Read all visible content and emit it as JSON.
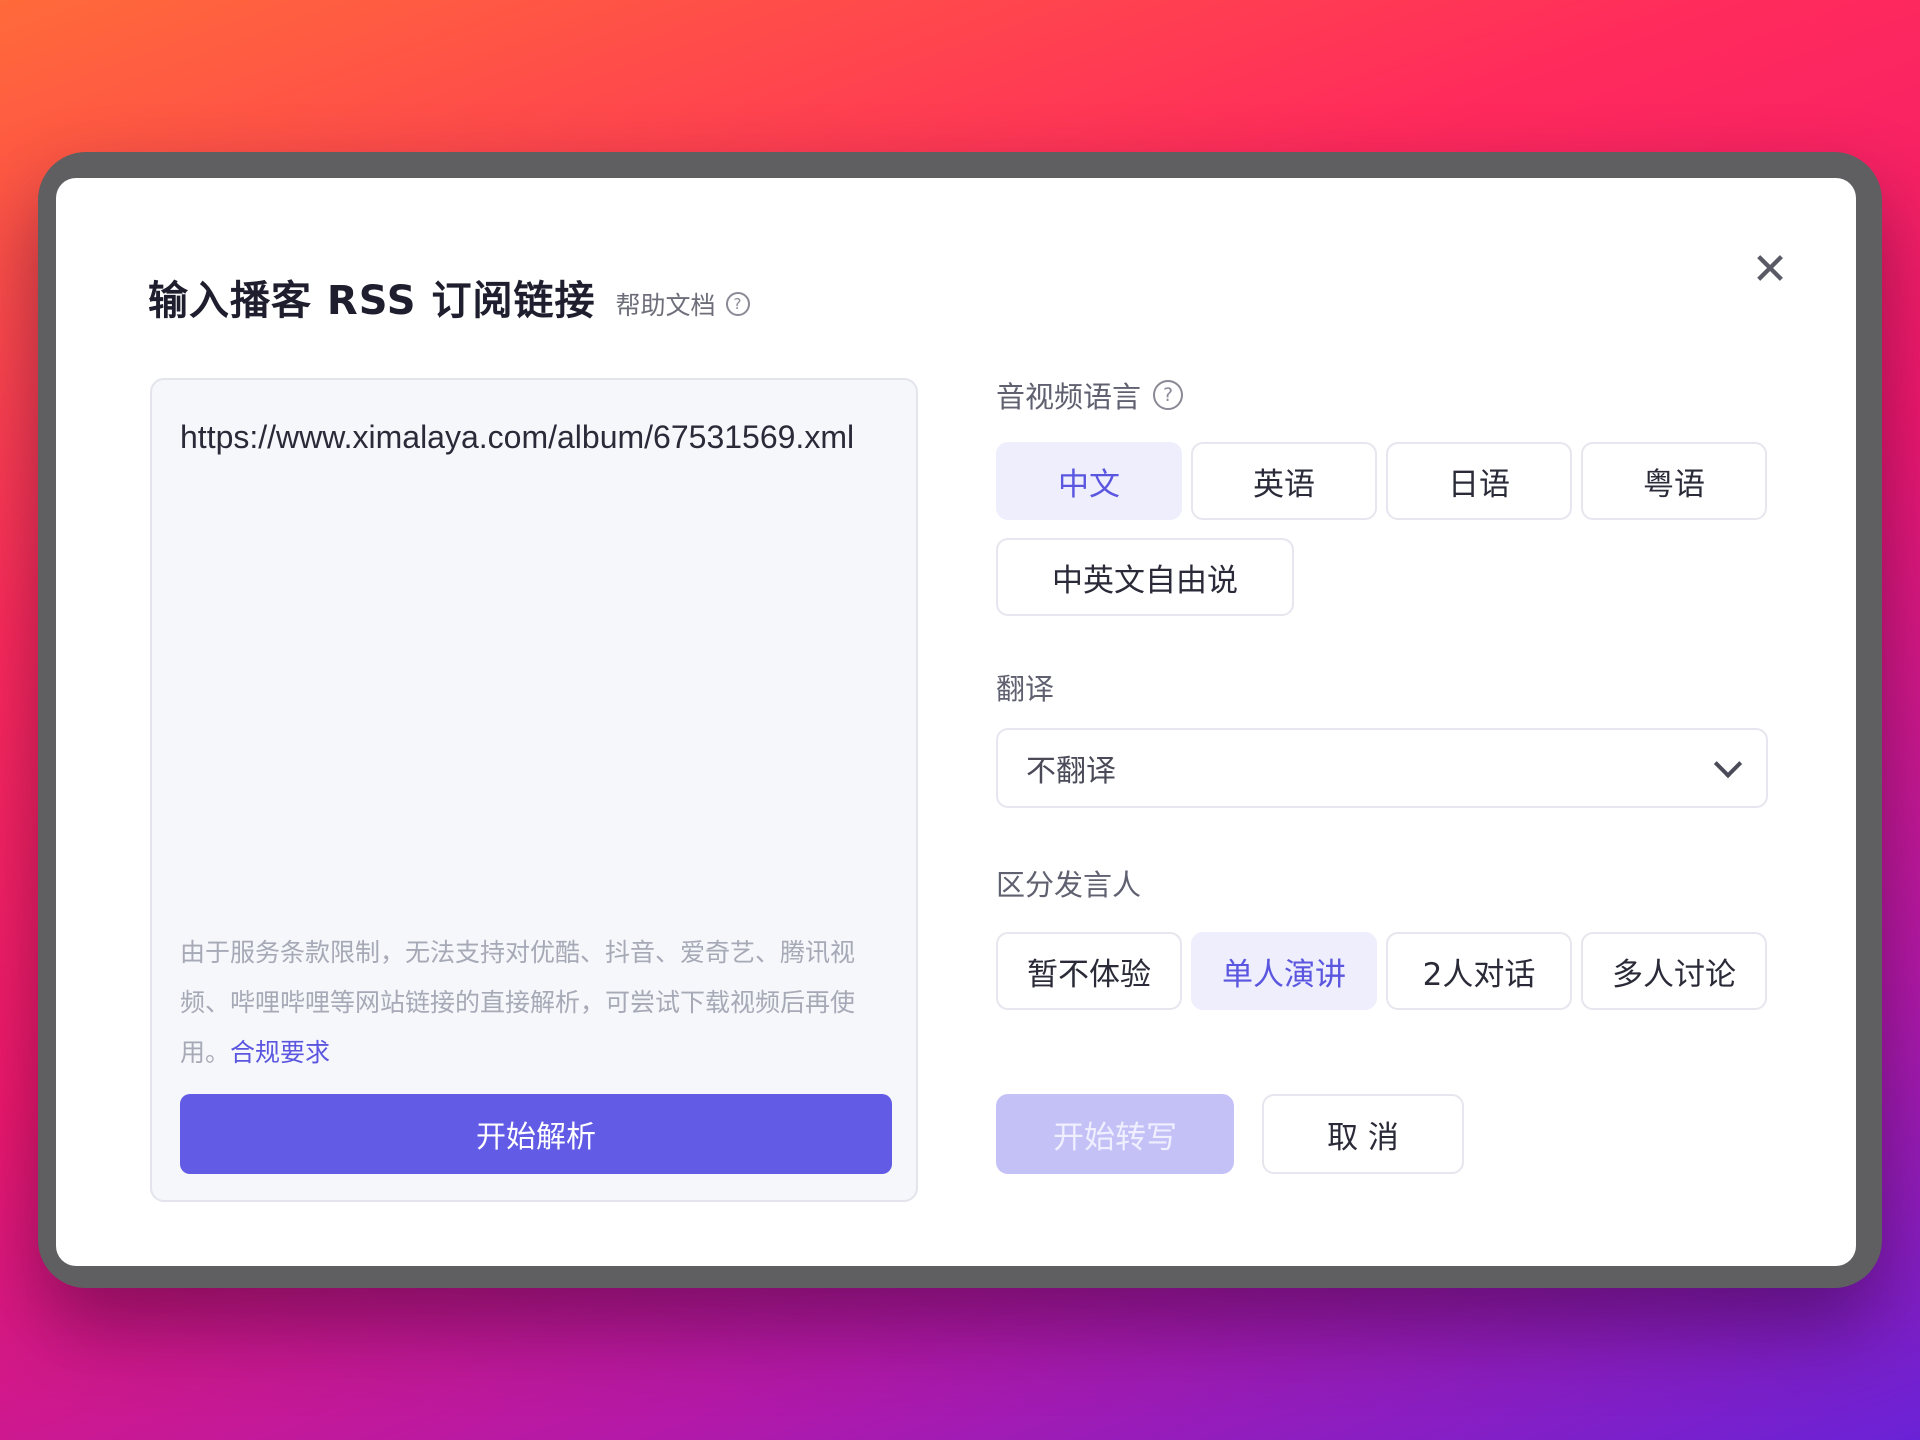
{
  "dialog": {
    "title": "输入播客 RSS 订阅链接",
    "help_label": "帮助文档",
    "help_icon": "question-circle-icon",
    "close_icon": "close-icon",
    "close_symbol": "✕"
  },
  "input": {
    "url_value": "https://www.ximalaya.com/album/67531569.xml",
    "notice_text": "由于服务条款限制，无法支持对优酷、抖音、爱奇艺、腾讯视频、哔哩哔哩等网站链接的直接解析，可尝试下载视频后再使用。",
    "compliance_link": "合规要求",
    "parse_button": "开始解析"
  },
  "language": {
    "label": "音视频语言",
    "options": [
      "中文",
      "英语",
      "日语",
      "粤语",
      "中英文自由说"
    ],
    "selected": "中文"
  },
  "translation": {
    "label": "翻译",
    "selected": "不翻译"
  },
  "speakers": {
    "label": "区分发言人",
    "options": [
      "暂不体验",
      "单人演讲",
      "2人对话",
      "多人讨论"
    ],
    "selected": "单人演讲"
  },
  "actions": {
    "start_label": "开始转写",
    "cancel_label": "取 消"
  },
  "colors": {
    "primary": "#615be6",
    "primary_disabled": "#c3c1f6",
    "active_bg": "#eeeefc"
  }
}
